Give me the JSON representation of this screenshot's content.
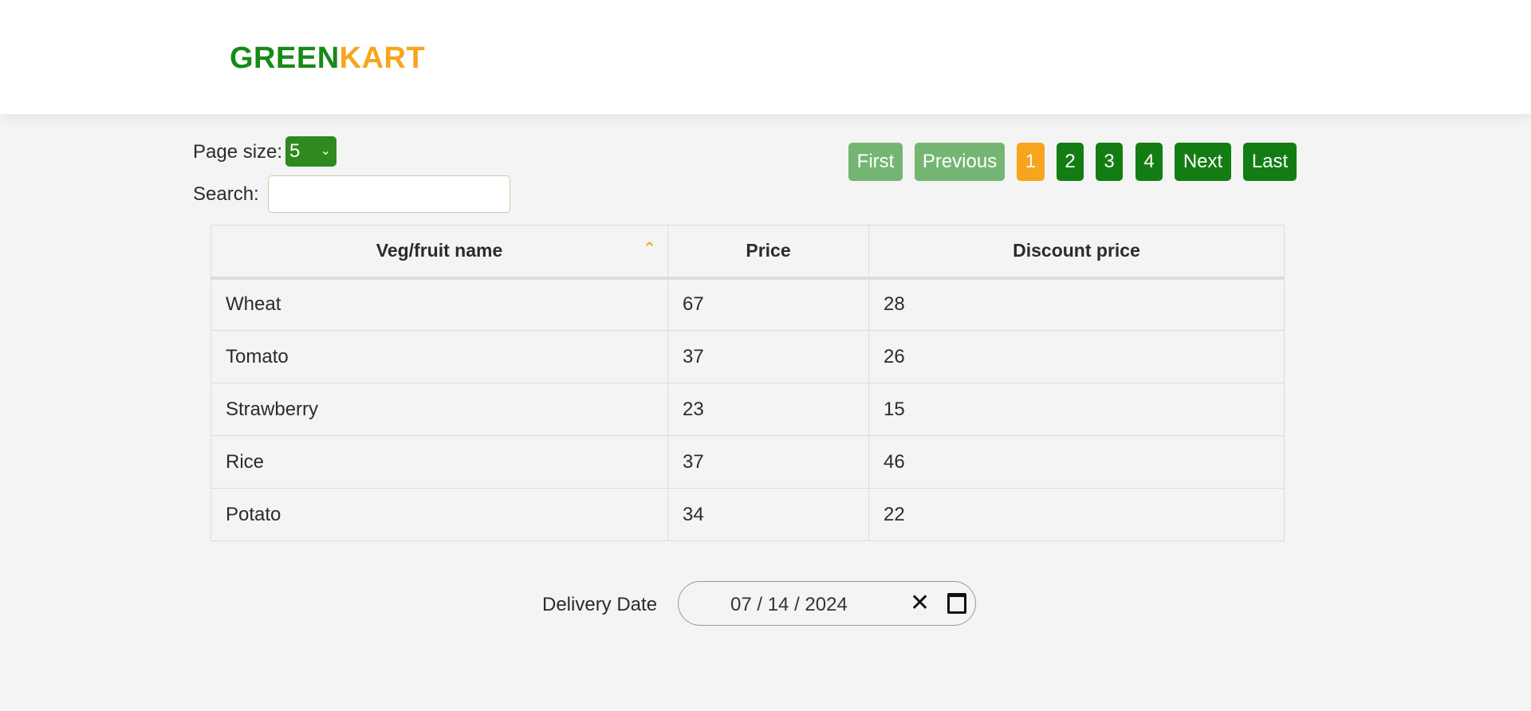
{
  "brand": {
    "part1": "GREEN",
    "part2": "KART"
  },
  "page_size": {
    "label": "Page size:",
    "value": "5",
    "chevron": "chevron-down-icon"
  },
  "search": {
    "label": "Search:",
    "value": "",
    "placeholder": ""
  },
  "pagination": {
    "first": "First",
    "previous": "Previous",
    "pages": [
      "1",
      "2",
      "3",
      "4"
    ],
    "active_page": "1",
    "next": "Next",
    "last": "Last"
  },
  "table": {
    "headers": [
      "Veg/fruit name",
      "Price",
      "Discount price"
    ],
    "sort_icon": "chevron-up-icon",
    "rows": [
      [
        "Wheat",
        "67",
        "28"
      ],
      [
        "Tomato",
        "37",
        "26"
      ],
      [
        "Strawberry",
        "23",
        "15"
      ],
      [
        "Rice",
        "37",
        "46"
      ],
      [
        "Potato",
        "34",
        "22"
      ]
    ]
  },
  "delivery": {
    "label": "Delivery Date",
    "date": "07 / 14 / 2024"
  },
  "colors": {
    "green": "#178a17",
    "orange": "#f7a51c",
    "pager_green": "#137d13"
  }
}
